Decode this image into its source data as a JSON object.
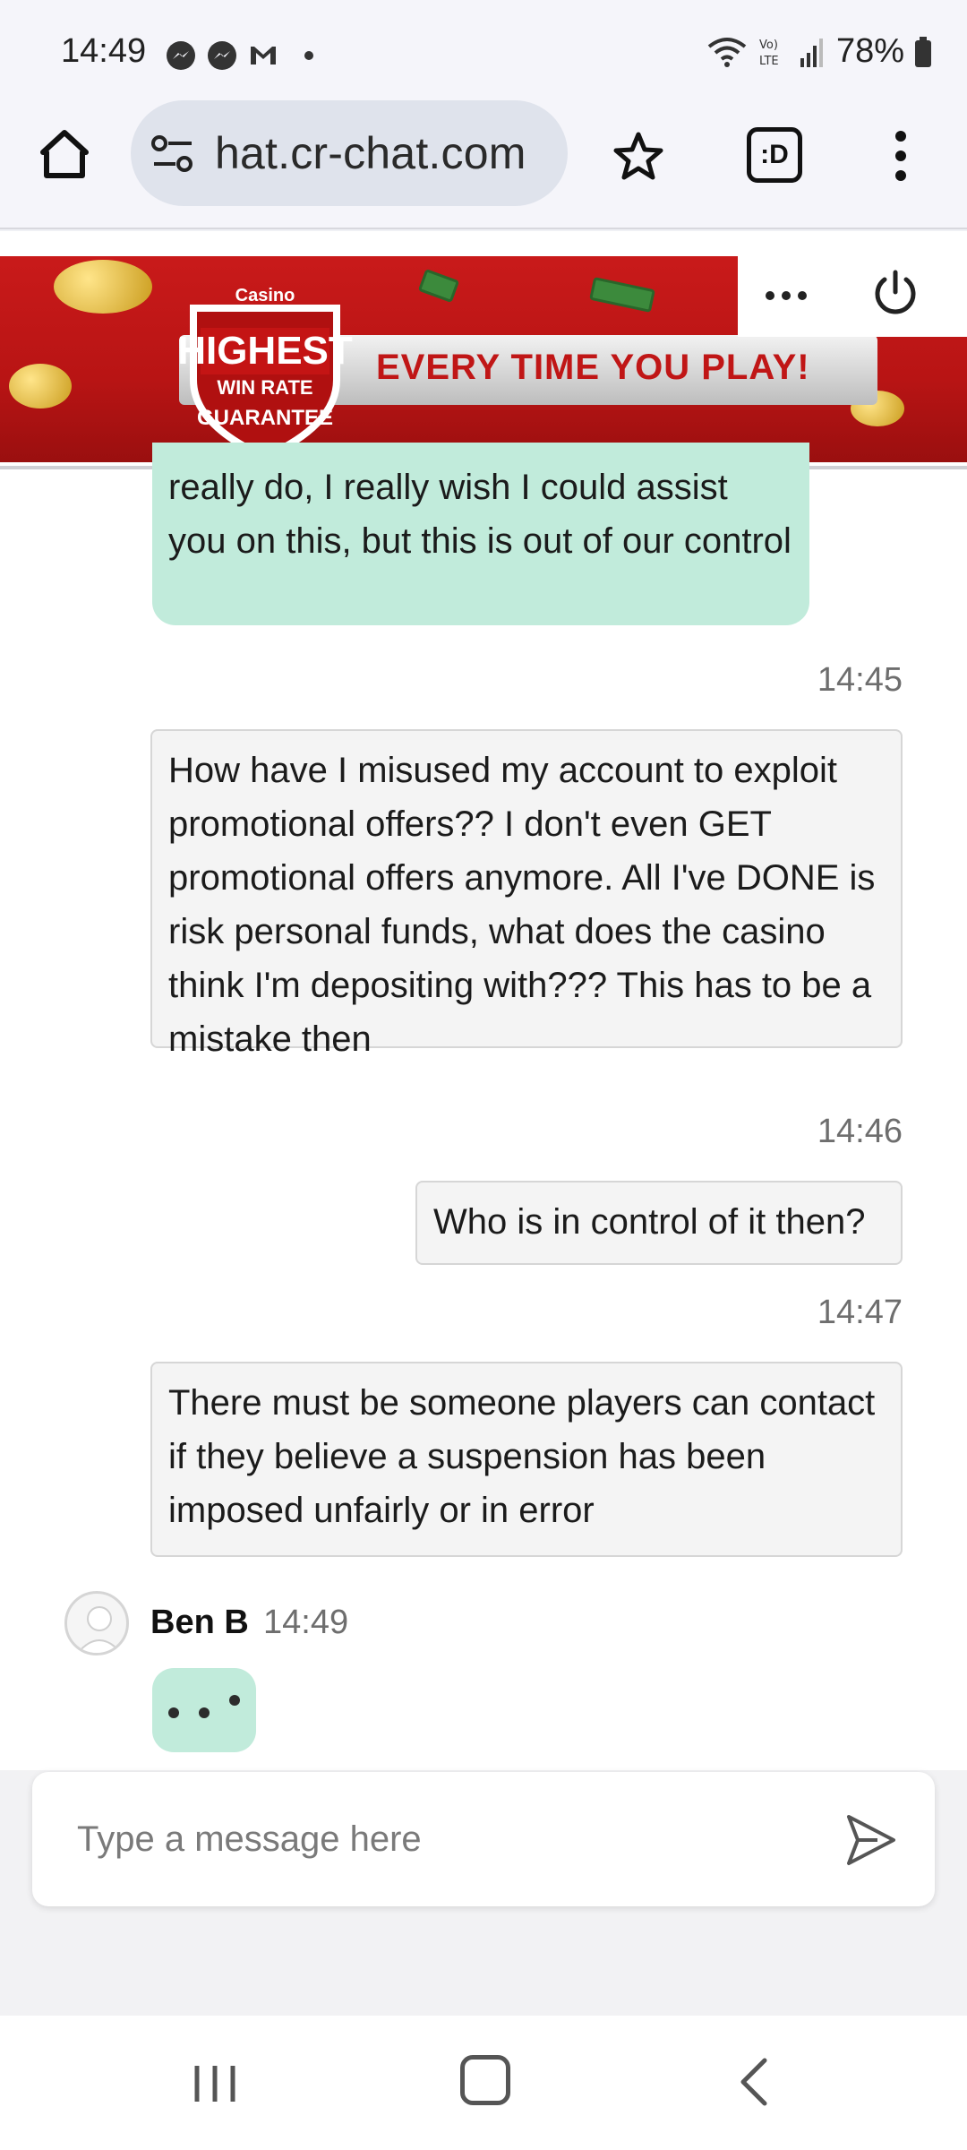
{
  "status_bar": {
    "time": "14:49",
    "battery": "78%",
    "icons": [
      "messenger-icon",
      "messenger-icon",
      "gmail-icon",
      "wifi-icon",
      "volte-icon",
      "signal-icon",
      "battery-icon"
    ]
  },
  "browser": {
    "url": "hat.cr-chat.com",
    "tab_label": ":D"
  },
  "banner": {
    "logo_text": "Casino Rewards",
    "shield_line1": "HIGHEST",
    "shield_line2": "WIN RATE",
    "shield_line3": "GUARANTEE",
    "tagline": "EVERY TIME YOU PLAY!"
  },
  "messages": [
    {
      "role": "agent",
      "text": "really do, I really wish I could assist you on this, but this is out of our control"
    },
    {
      "role": "user",
      "time": "14:45",
      "text": "How have I misused my account to exploit promotional offers?? I don't even GET promotional offers anymore. All I've DONE is risk personal funds, what does the casino think I'm depositing with??? This has to be a mistake then"
    },
    {
      "role": "user",
      "time": "14:46",
      "text": "Who is in control of it then?"
    },
    {
      "role": "user",
      "time": "14:47",
      "text": "There must be someone players can contact if they believe a suspension has been imposed unfairly or in error"
    }
  ],
  "agent": {
    "name": "Ben B",
    "time": "14:49"
  },
  "composer": {
    "placeholder": "Type a message here"
  }
}
